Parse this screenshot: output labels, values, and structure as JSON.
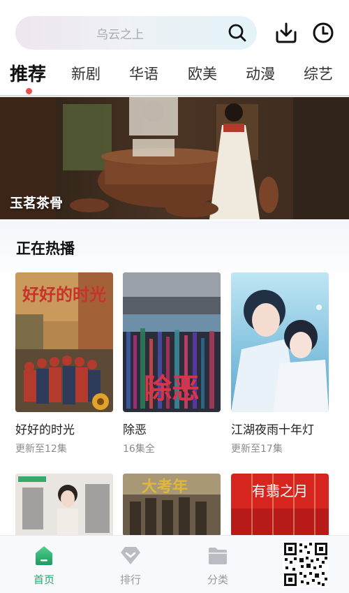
{
  "search": {
    "placeholder": "乌云之上"
  },
  "header": {
    "icons": [
      "search-icon",
      "download-icon",
      "history-icon"
    ]
  },
  "tabs": [
    {
      "label": "推荐",
      "active": true
    },
    {
      "label": "新剧",
      "active": false
    },
    {
      "label": "华语",
      "active": false
    },
    {
      "label": "欧美",
      "active": false
    },
    {
      "label": "动漫",
      "active": false
    },
    {
      "label": "综艺",
      "active": false
    }
  ],
  "banner": {
    "title": "玉茗茶骨"
  },
  "section": {
    "title": "正在热播"
  },
  "cards": [
    {
      "title": "好好的时光",
      "subtitle": "更新至12集",
      "poster_text": "好好的时光"
    },
    {
      "title": "除恶",
      "subtitle": "16集全",
      "poster_text": "除恶"
    },
    {
      "title": "江湖夜雨十年灯",
      "subtitle": "更新至17集",
      "poster_text": ""
    }
  ],
  "row2_posters": [
    {
      "poster_text": ""
    },
    {
      "poster_text": "大考年"
    },
    {
      "poster_text": "有翡之月"
    }
  ],
  "bottom_nav": [
    {
      "label": "首页",
      "icon": "home-icon",
      "active": true
    },
    {
      "label": "排行",
      "icon": "ranking-icon",
      "active": false
    },
    {
      "label": "分类",
      "icon": "category-folder-icon",
      "active": false
    }
  ],
  "colors": {
    "accent": "#2aa86b",
    "tab_dot": "#e8524a"
  }
}
